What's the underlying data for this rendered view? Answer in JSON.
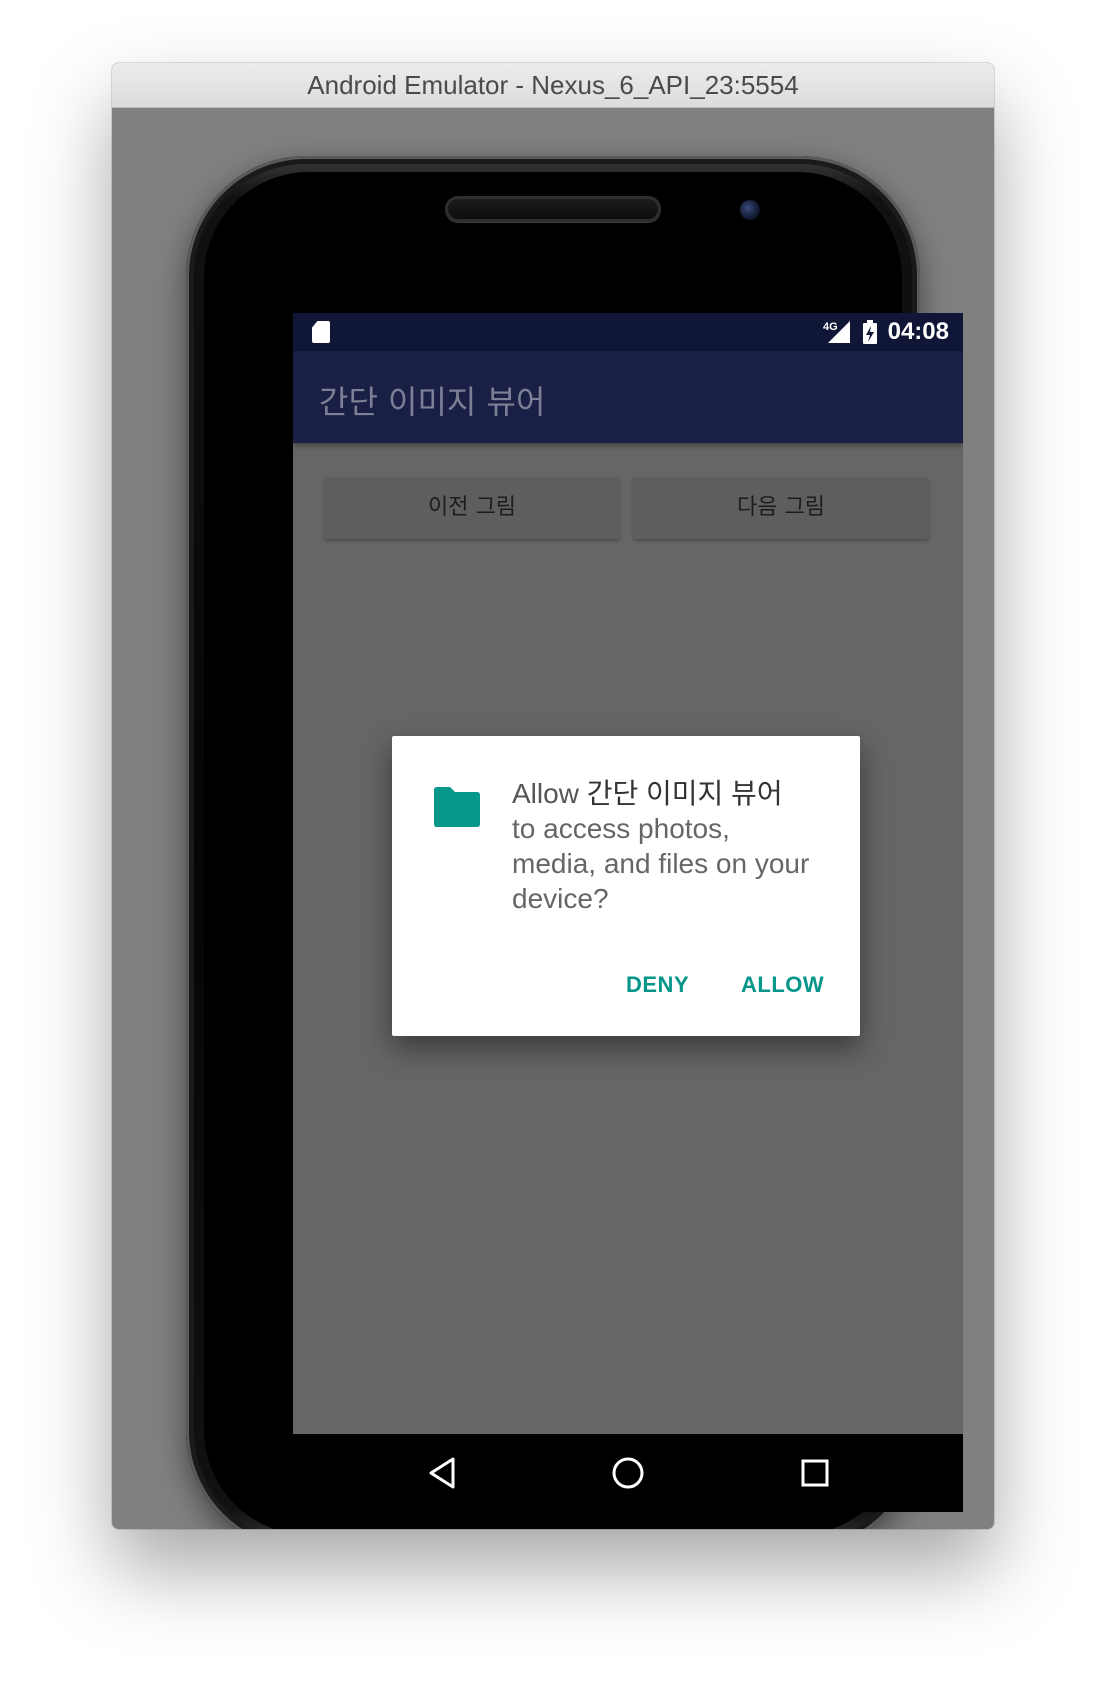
{
  "window": {
    "title": "Android Emulator - Nexus_6_API_23:5554"
  },
  "statusbar": {
    "sd_icon": "sd-card-icon",
    "signal_badge": "4G",
    "signal_icon": "signal-icon",
    "battery_icon": "battery-charging-icon",
    "time": "04:08"
  },
  "appbar": {
    "title": "간단 이미지 뷰어"
  },
  "buttons": {
    "prev_label": "이전 그림",
    "next_label": "다음 그림"
  },
  "permission_dialog": {
    "icon": "folder-icon",
    "message_prefix": "Allow ",
    "app_name": "간단 이미지 뷰어",
    "message_suffix": " to access photos, media, and files on your device?",
    "deny_label": "DENY",
    "allow_label": "ALLOW",
    "accent_color": "#06968a"
  },
  "navbar": {
    "back_icon": "back-triangle-icon",
    "home_icon": "home-circle-icon",
    "recents_icon": "recents-square-icon"
  },
  "colors": {
    "status_bar": "#0f1636",
    "app_bar": "#1a1f46",
    "screen_background": "#666666",
    "dialog_button": "#06968a"
  }
}
